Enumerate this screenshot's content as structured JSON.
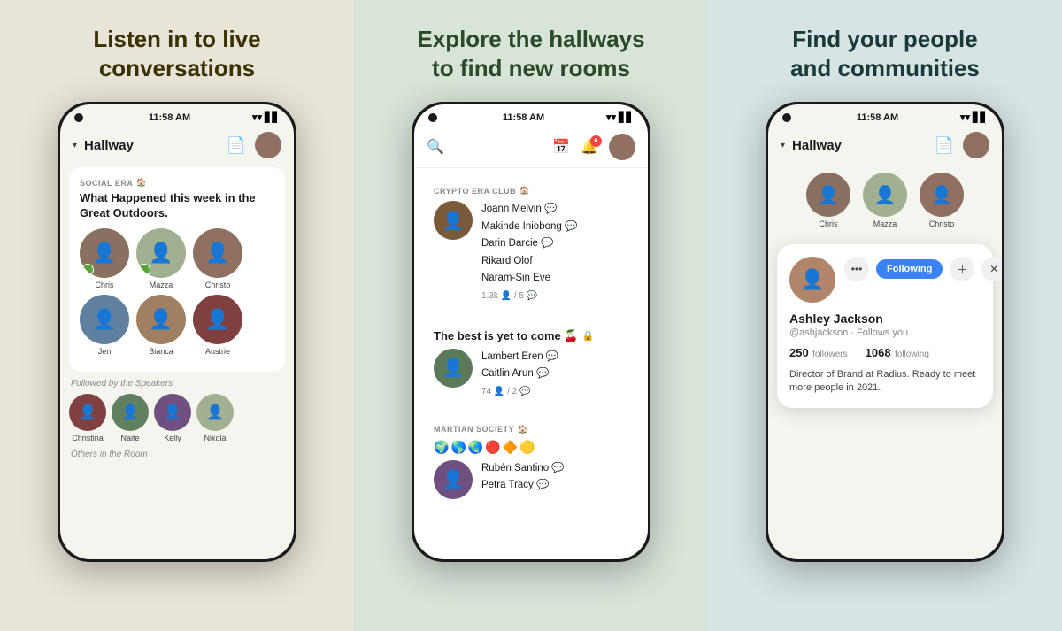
{
  "panels": [
    {
      "id": "panel-1",
      "title": "Listen in to live\nconversations",
      "phone": {
        "time": "11:58 AM",
        "nav": {
          "label": "Hallway",
          "icons": [
            "document",
            "avatar"
          ]
        },
        "room": {
          "club_label": "SOCIAL ERA",
          "club_icon": "🏠",
          "room_title": "What Happened this week in the Great Outdoors.",
          "speakers": [
            {
              "name": "Chris",
              "badge": "🌿",
              "bg": "bg-1"
            },
            {
              "name": "Mazza",
              "badge": "🌿",
              "bg": "bg-2"
            },
            {
              "name": "Christo",
              "badge": "",
              "bg": "bg-3"
            }
          ],
          "speakers2": [
            {
              "name": "Jen",
              "badge": "",
              "bg": "bg-4"
            },
            {
              "name": "Bianca",
              "badge": "",
              "bg": "bg-5"
            },
            {
              "name": "Austrie",
              "badge": "",
              "bg": "bg-6"
            }
          ],
          "followed_label": "Followed by the Speakers",
          "followed": [
            {
              "name": "Christina",
              "bg": "bg-6"
            },
            {
              "name": "Naite",
              "bg": "bg-7"
            },
            {
              "name": "Kelly",
              "bg": "bg-8"
            },
            {
              "name": "Nikola",
              "bg": "bg-2"
            }
          ],
          "others_label": "Others in the Room"
        }
      }
    },
    {
      "id": "panel-2",
      "title": "Explore the hallways\nto find new rooms",
      "phone": {
        "time": "11:58 AM",
        "rooms": [
          {
            "club_label": "CRYPTO ERA CLUB",
            "club_icon": "🏠",
            "names": [
              "Joann Melvin",
              "Makinde Iniobong",
              "Darin Darcie",
              "Rikard Olof",
              "Naram-Sin Eve"
            ],
            "stats": "1.3k 👤 / 5 💬",
            "avatar_bg": "bg-11"
          },
          {
            "club_label": "The best is yet to come 🍒",
            "club_icon": "🔒",
            "names": [
              "Lambert Eren",
              "Caitlin Arun"
            ],
            "stats": "74 👤 / 2 💬",
            "avatar_bg": "bg-10",
            "locked": true
          },
          {
            "club_label": "MARTIAN SOCIETY",
            "club_icon": "🏠",
            "names": [
              "Rubén Santino",
              "Petra Tracy"
            ],
            "stats": "",
            "avatar_bg": "bg-8",
            "emojis": [
              "🌍",
              "🌎",
              "🌏",
              "🔴",
              "🔶",
              "🟡"
            ]
          }
        ]
      }
    },
    {
      "id": "panel-3",
      "title": "Find your people\nand communities",
      "phone": {
        "time": "11:58 AM",
        "nav": {
          "label": "Hallway",
          "icons": [
            "document",
            "avatar"
          ]
        },
        "speakers": [
          {
            "name": "Chris",
            "bg": "bg-1"
          },
          {
            "name": "Mazza",
            "bg": "bg-2"
          },
          {
            "name": "Christo",
            "bg": "bg-3"
          }
        ],
        "profile": {
          "name": "Ashley Jackson",
          "handle": "@ashjackson",
          "follows_you": "Follows you",
          "followers": "250",
          "followers_label": "followers",
          "following": "1068",
          "following_label": "following",
          "bio": "Director of Brand at Radius. Ready to meet more people in 2021.",
          "following_btn": "Following",
          "close_btn": "✕"
        }
      }
    }
  ]
}
